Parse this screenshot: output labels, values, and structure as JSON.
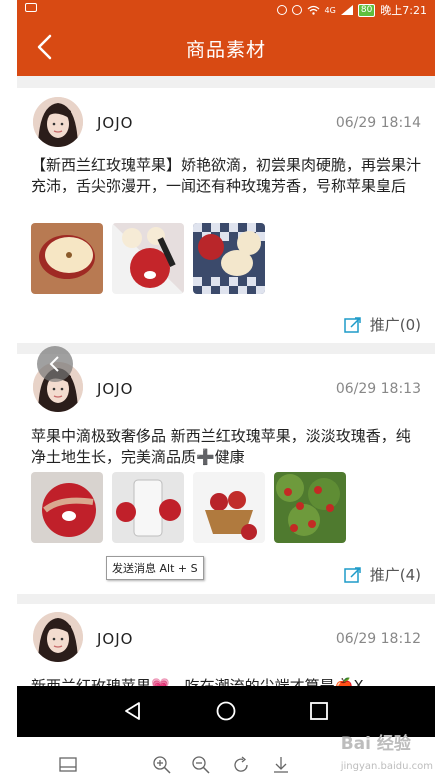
{
  "status_bar": {
    "carrier": "4G",
    "battery": "80",
    "time": "晚上7:21"
  },
  "header": {
    "title": "商品素材"
  },
  "posts": [
    {
      "user": "JOJO",
      "time": "06/29 18:14",
      "text": "【新西兰红玫瑰苹果】娇艳欲滴，初尝果肉硬脆，再尝果汁充沛，舌尖弥漫开，一闻还有种玫瑰芳香，号称苹果皇后",
      "promote": "推广(0)"
    },
    {
      "user": "JOJO",
      "time": "06/29 18:13",
      "text": "苹果中滴极致奢侈品 新西兰红玫瑰苹果，淡淡玫瑰香，纯净土地生长，完美滴品质➕健康",
      "promote": "推广(4)"
    },
    {
      "user": "JOJO",
      "time": "06/29 18:12",
      "text": "新西兰红玫瑰苹果💗，吃在潮流的尖端才算是🍎X"
    }
  ],
  "tooltip": "发送消息 Alt + S",
  "watermark": {
    "brand": "Bai 经验",
    "sub": "jingyan.baidu.com"
  },
  "icons": {
    "back": "back-arrow-icon",
    "share": "share-icon",
    "nav_back": "triangle-back-icon",
    "nav_home": "circle-home-icon",
    "nav_recent": "square-recent-icon"
  }
}
